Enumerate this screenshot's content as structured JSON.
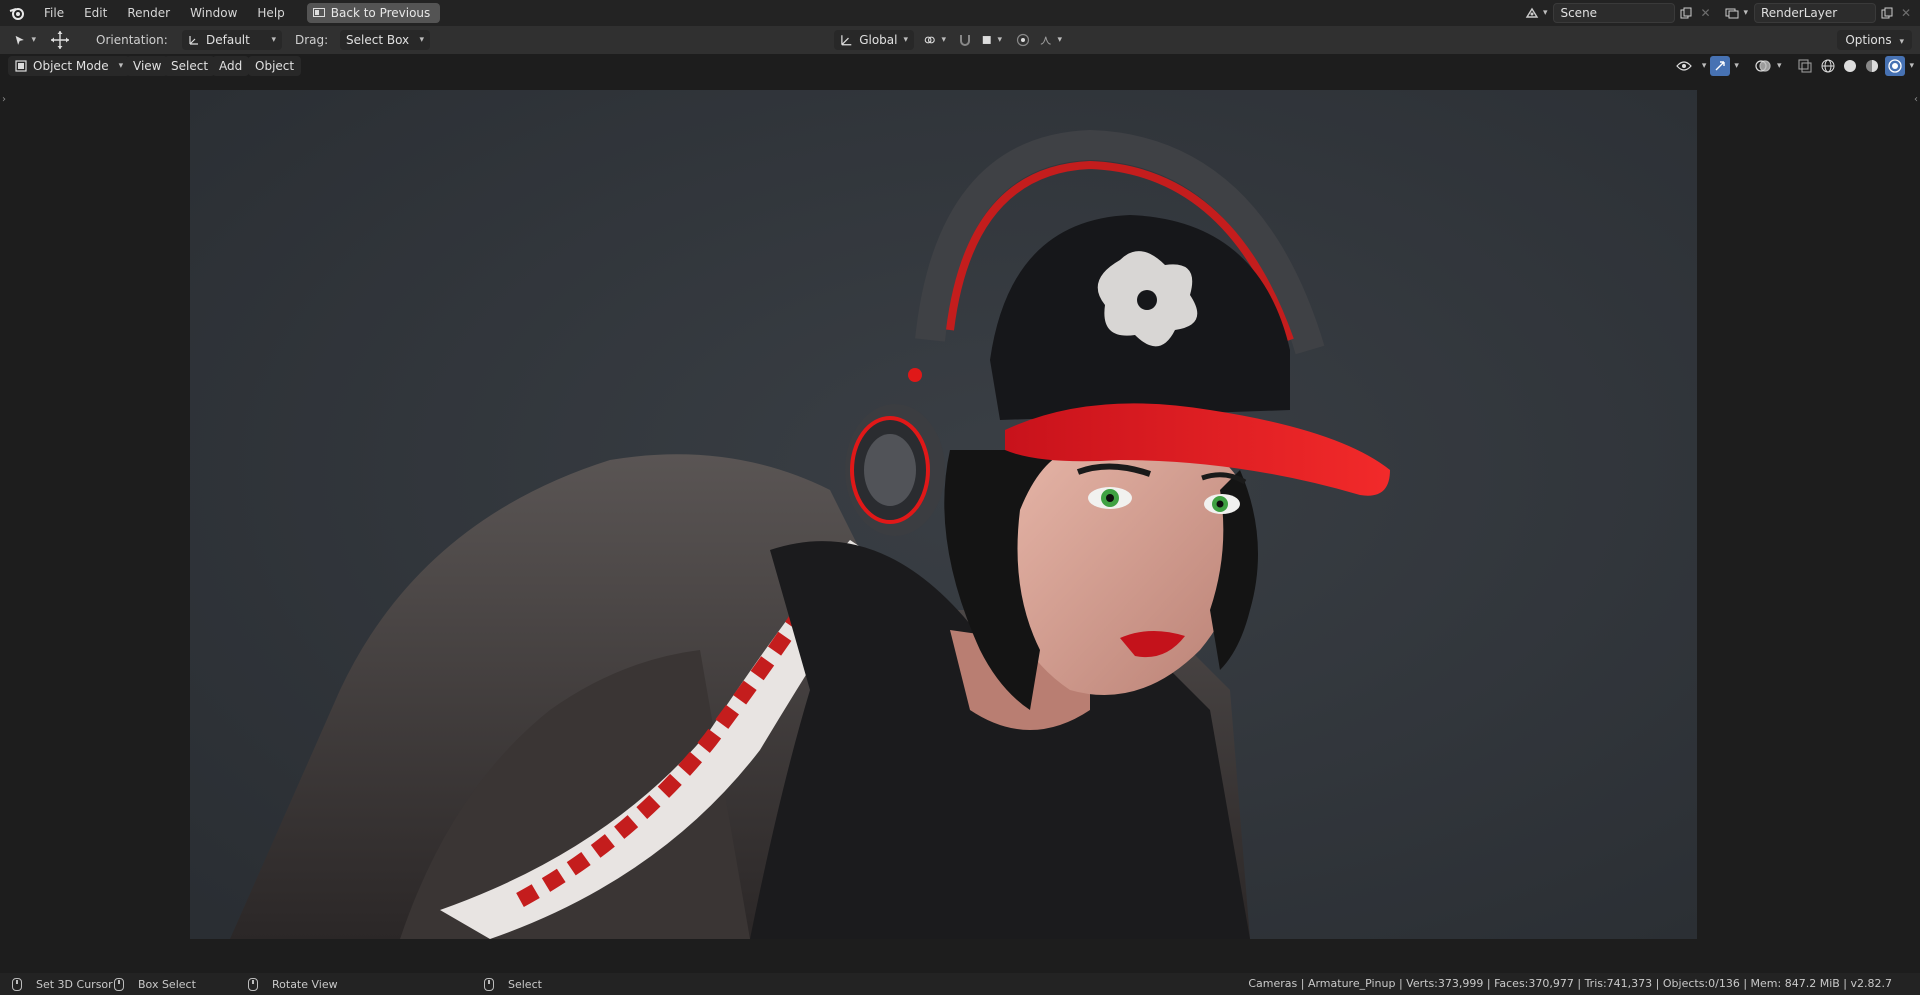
{
  "menu": {
    "items": [
      "File",
      "Edit",
      "Render",
      "Window",
      "Help"
    ],
    "back_button": "Back to Previous"
  },
  "top_right": {
    "scene": "Scene",
    "view_layer": "RenderLayer"
  },
  "tool_settings": {
    "orientation_label": "Orientation:",
    "orientation_value": "Default",
    "drag_label": "Drag:",
    "drag_value": "Select Box",
    "transform_orientation": "Global",
    "options_label": "Options"
  },
  "header": {
    "mode": "Object Mode",
    "view": "View",
    "select": "Select",
    "add": "Add",
    "object": "Object"
  },
  "status": {
    "set_cursor": "Set 3D Cursor",
    "box_select": "Box Select",
    "rotate_view": "Rotate View",
    "select": "Select",
    "stats": "Cameras | Armature_Pinup | Verts:373,999 | Faces:370,977 | Tris:741,373 | Objects:0/136 | Mem: 847.2 MiB | v2.82.7"
  },
  "colors": {
    "accent_red": "#e01818",
    "background": "#2f3338",
    "toolbar": "#303030"
  }
}
